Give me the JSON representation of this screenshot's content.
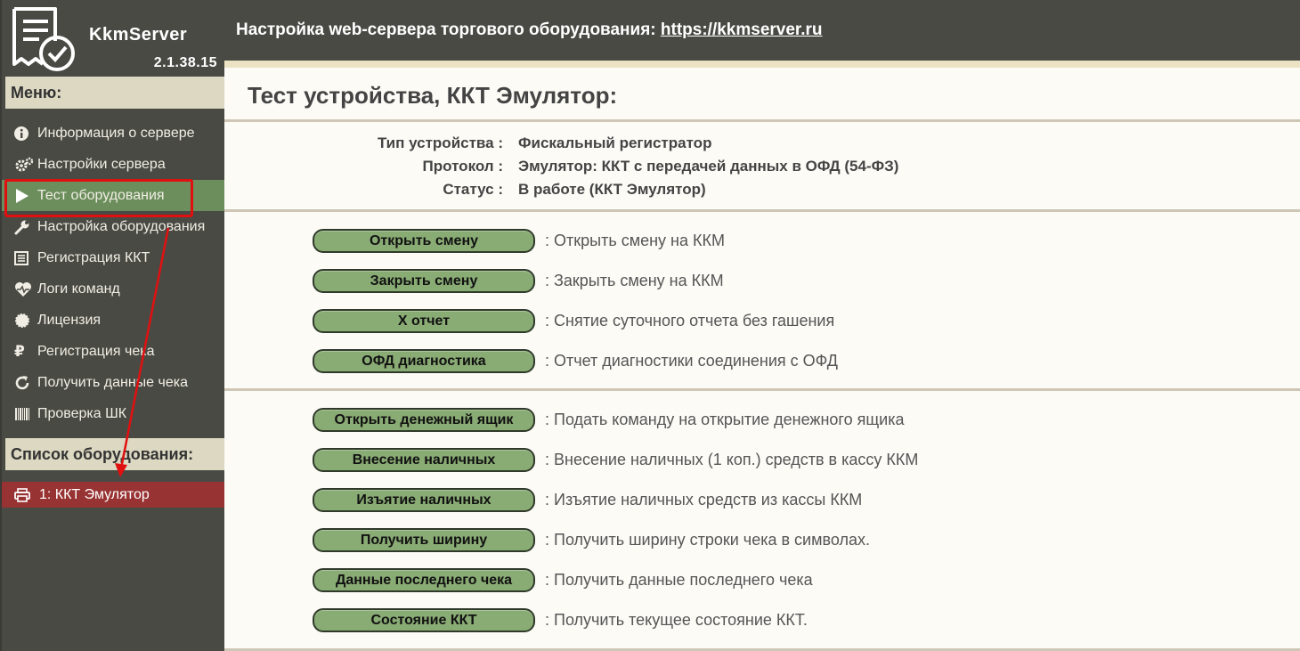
{
  "app": {
    "name": "KkmServer",
    "version": "2.1.38.15"
  },
  "header": {
    "title_prefix": "Настройка web-сервера торгового оборудования: ",
    "link_text": "https://kkmserver.ru"
  },
  "sidebar": {
    "menu_heading": "Меню:",
    "items": [
      {
        "label": "Информация о сервере",
        "icon": "info-icon"
      },
      {
        "label": "Настройки сервера",
        "icon": "gears-icon"
      },
      {
        "label": "Тест оборудования",
        "icon": "play-icon",
        "active": true
      },
      {
        "label": "Настройка оборудования",
        "icon": "wrench-icon"
      },
      {
        "label": "Регистрация ККТ",
        "icon": "list-icon"
      },
      {
        "label": "Логи команд",
        "icon": "heartbeat-icon"
      },
      {
        "label": "Лицензия",
        "icon": "certificate-icon"
      },
      {
        "label": "Регистрация чека",
        "icon": "ruble-icon"
      },
      {
        "label": "Получить данные чека",
        "icon": "refresh-icon"
      },
      {
        "label": "Проверка ШК",
        "icon": "barcode-icon"
      }
    ],
    "equipment_heading": "Список оборудования:",
    "equipment": [
      {
        "label": "1: ККТ Эмулятор",
        "icon": "printer-icon"
      }
    ]
  },
  "main": {
    "title": "Тест устройства, ККТ Эмулятор:",
    "info": [
      {
        "label": "Тип устройства :",
        "value": "Фискальный регистратор"
      },
      {
        "label": "Протокол :",
        "value": "Эмулятор: ККТ с передачей данных в ОФД (54-ФЗ)"
      },
      {
        "label": "Статус :",
        "value": "В работе (ККТ Эмулятор)"
      }
    ],
    "actions_group1": [
      {
        "button": "Открыть смену",
        "desc": ": Открыть смену на ККМ"
      },
      {
        "button": "Закрыть смену",
        "desc": ": Закрыть смену на ККМ"
      },
      {
        "button": "X отчет",
        "desc": ": Снятие суточного отчета без гашения"
      },
      {
        "button": "ОФД диагностика",
        "desc": ": Отчет диагностики соединения с ОФД"
      }
    ],
    "actions_group2": [
      {
        "button": "Открыть денежный ящик",
        "desc": ": Подать команду на открытие денежного ящика"
      },
      {
        "button": "Внесение наличных",
        "desc": ": Внесение наличных (1 коп.) средств в кассу ККМ"
      },
      {
        "button": "Изъятие наличных",
        "desc": ": Изъятие наличных средств из кассы ККМ"
      },
      {
        "button": "Получить ширину",
        "desc": ": Получить ширину строки чека в символах."
      },
      {
        "button": "Данные последнего чека",
        "desc": ": Получить данные последнего чека"
      },
      {
        "button": "Состояние ККТ",
        "desc": ": Получить текущее состояние ККТ."
      }
    ]
  },
  "colors": {
    "sidebar_bg": "#4a4a44",
    "active_item": "#6c8e5c",
    "equipment_item": "#983333",
    "button": "#89ab74",
    "annotation": "#e01010"
  }
}
